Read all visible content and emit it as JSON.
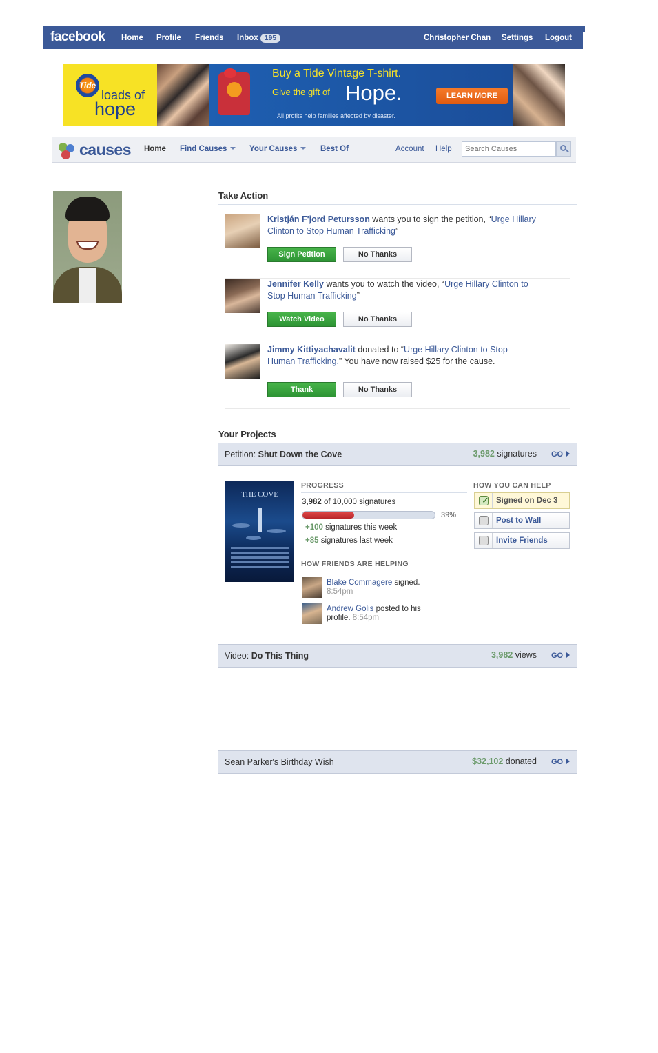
{
  "facebook": {
    "logo": "facebook",
    "nav": [
      "Home",
      "Profile",
      "Friends"
    ],
    "inbox_label": "Inbox",
    "inbox_count": "195",
    "user_name": "Christopher Chan",
    "settings": "Settings",
    "logout": "Logout",
    "brand_color": "#3b5998"
  },
  "ad": {
    "brand": "Tide",
    "loads_of": "loads of",
    "hope_logo": "hope",
    "headline": "Buy a Tide Vintage T-shirt.",
    "gift_text": "Give the gift of",
    "big_word": "Hope.",
    "fine_print": "All profits help families affected by disaster.",
    "cta": "LEARN MORE"
  },
  "causes_nav": {
    "logo": "causes",
    "home": "Home",
    "find_causes": "Find Causes",
    "your_causes": "Your Causes",
    "best_of": "Best Of",
    "account": "Account",
    "help": "Help",
    "search_placeholder": "Search Causes"
  },
  "take_action": {
    "title": "Take Action",
    "items": [
      {
        "who": "Kristján F'jord Petursson",
        "text": " wants you to sign the petition, “",
        "cause": "Urge Hillary Clinton to Stop Human Trafficking",
        "after": "”",
        "primary": "Sign Petition",
        "secondary": "No Thanks"
      },
      {
        "who": "Jennifer Kelly",
        "text": " wants you to watch the video, “",
        "cause": "Urge Hillary Clinton to Stop Human Trafficking",
        "after": "”",
        "primary": "Watch Video",
        "secondary": "No Thanks"
      },
      {
        "who": "Jimmy Kittiyachavalit",
        "text": " donated to “",
        "cause": "Urge Hillary Clinton to Stop Human Trafficking.",
        "after": "” You have now raised $25 for the cause.",
        "primary": "Thank",
        "secondary": "No Thanks"
      }
    ]
  },
  "projects": {
    "title": "Your Projects",
    "go": "GO",
    "petition": {
      "type": "Petition: ",
      "name": "Shut Down the Cove",
      "count": "3,982",
      "unit": " signatures",
      "poster_title": "THE COVE",
      "progress_heading": "PROGRESS",
      "current": "3,982",
      "of_goal": " of 10,000 signatures",
      "progress_fraction": 0.39,
      "percent": "39%",
      "this_week_num": "+100",
      "this_week": " signatures this week",
      "last_week_num": "+85",
      "last_week": " signatures last week",
      "friends_heading": "HOW FRIENDS ARE HELPING",
      "friends": [
        {
          "name": "Blake Commagere",
          "action": " signed.",
          "time": "8:54pm"
        },
        {
          "name": "Andrew Golis",
          "action": " posted to his profile.",
          "time": " 8:54pm"
        }
      ],
      "help_heading": "HOW YOU CAN HELP",
      "help": [
        {
          "label": "Signed on Dec 3",
          "done": true
        },
        {
          "label": "Post to Wall",
          "done": false
        },
        {
          "label": "Invite Friends",
          "done": false
        }
      ]
    },
    "video": {
      "type": "Video: ",
      "name": "Do This Thing",
      "count": "3,982",
      "unit": " views"
    },
    "birthday": {
      "name": "Sean Parker's Birthday Wish",
      "count": "$32,102",
      "unit": " donated"
    }
  }
}
